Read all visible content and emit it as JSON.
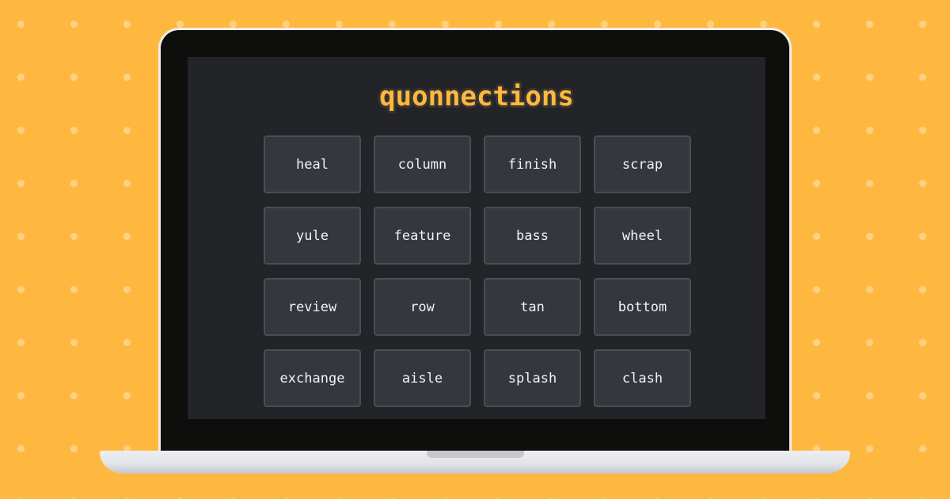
{
  "app": {
    "title": "quonnections"
  },
  "grid": {
    "words": [
      "heal",
      "column",
      "finish",
      "scrap",
      "yule",
      "feature",
      "bass",
      "wheel",
      "review",
      "row",
      "tan",
      "bottom",
      "exchange",
      "aisle",
      "splash",
      "clash"
    ]
  },
  "colors": {
    "background": "#FFB83F",
    "screen": "#222428",
    "tile": "#34373D",
    "tile_border": "#4A4D54",
    "title": "#FFB83F"
  }
}
